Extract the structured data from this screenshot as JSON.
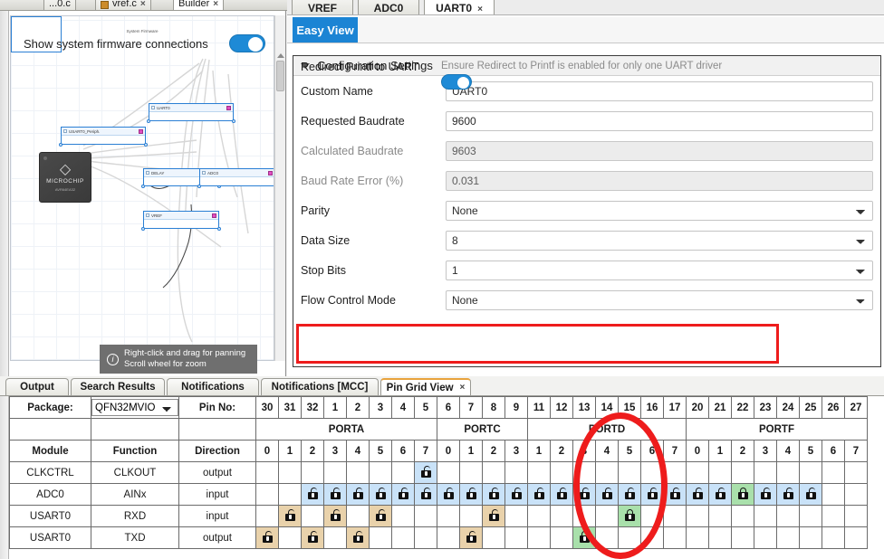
{
  "editor_tabs": [
    {
      "label": "...0.c",
      "closable": false,
      "active": false
    },
    {
      "label": "vref.c",
      "closable": true,
      "active": false
    },
    {
      "label": "Builder",
      "closable": true,
      "active": true
    }
  ],
  "nav_buttons": [
    "◄",
    "►",
    "▾",
    "□"
  ],
  "component_tabs": [
    {
      "label": "VREF",
      "active": false,
      "closable": false
    },
    {
      "label": "ADC0",
      "active": false,
      "closable": false
    },
    {
      "label": "UART0",
      "active": true,
      "closable": true,
      "close_label": "×"
    }
  ],
  "diagram": {
    "show_firmware_label": "Show system firmware connections",
    "show_firmware_on": true,
    "nodes": [
      {
        "name": "System Firmware"
      },
      {
        "name": "UART0"
      },
      {
        "name": "USART0_Periph."
      },
      {
        "name": "DELAY"
      },
      {
        "name": "ADC0"
      },
      {
        "name": "VREF"
      }
    ],
    "chip": {
      "brand": "MICROCHIP",
      "part": "AVR64EA32"
    },
    "hint_line1": "Right-click and drag for panning",
    "hint_line2": "Scroll wheel for zoom",
    "hint_icon": "info-icon"
  },
  "config": {
    "easy_view_label": "Easy View",
    "section_title": "Configuration Settings",
    "fields": [
      {
        "label": "Custom Name",
        "value": "UART0",
        "type": "text",
        "readonly": false
      },
      {
        "label": "Requested Baudrate",
        "value": "9600",
        "type": "text",
        "readonly": false
      },
      {
        "label": "Calculated Baudrate",
        "value": "9603",
        "type": "text",
        "readonly": true
      },
      {
        "label": "Baud Rate Error (%)",
        "value": "0.031",
        "type": "text",
        "readonly": true
      },
      {
        "label": "Parity",
        "value": "None",
        "type": "select",
        "readonly": false
      },
      {
        "label": "Data Size",
        "value": "8",
        "type": "select",
        "readonly": false
      },
      {
        "label": "Stop Bits",
        "value": "1",
        "type": "select",
        "readonly": false
      },
      {
        "label": "Flow Control Mode",
        "value": "None",
        "type": "select",
        "readonly": false
      }
    ],
    "redirect": {
      "label": "Redirect Printf to UART",
      "note": "Ensure Redirect to Printf is enabled for only one UART driver",
      "enabled": true,
      "highlight_color": "#ee1c1c"
    }
  },
  "bottom_tabs": [
    {
      "label": "Output",
      "active": false,
      "closable": false
    },
    {
      "label": "Search Results",
      "active": false,
      "closable": false
    },
    {
      "label": "Notifications",
      "active": false,
      "closable": false
    },
    {
      "label": "Notifications [MCC]",
      "active": false,
      "closable": false
    },
    {
      "label": "Pin Grid View",
      "active": true,
      "closable": true,
      "close_label": "×"
    }
  ],
  "pin_grid": {
    "package_label": "Package:",
    "package_value": "QFN32MVIO",
    "package_options": [
      "QFN32MVIO"
    ],
    "pin_no_label": "Pin No:",
    "col_module": "Module",
    "col_function": "Function",
    "col_direction": "Direction",
    "pin_numbers": [
      "30",
      "31",
      "32",
      "1",
      "2",
      "3",
      "4",
      "5",
      "6",
      "7",
      "8",
      "9",
      "11",
      "12",
      "13",
      "14",
      "15",
      "16",
      "17",
      "20",
      "21",
      "22",
      "23",
      "24",
      "25",
      "26",
      "27"
    ],
    "ports": [
      {
        "name": "PORTA",
        "span": 8
      },
      {
        "name": "PORTC",
        "span": 4
      },
      {
        "name": "",
        "span": 0
      },
      {
        "name": "PORTD",
        "span": 7
      },
      {
        "name": "PORTF",
        "span": 8
      }
    ],
    "port_bits": [
      "0",
      "1",
      "2",
      "3",
      "4",
      "5",
      "6",
      "7",
      "0",
      "1",
      "2",
      "3",
      "1",
      "2",
      "3",
      "4",
      "5",
      "6",
      "7",
      "0",
      "1",
      "2",
      "3",
      "4",
      "5",
      "6",
      "7"
    ],
    "rows": [
      {
        "module": "CLKCTRL",
        "function": "CLKOUT",
        "direction": "output",
        "cells": [
          "",
          "",
          "",
          "",
          "",
          "",
          "",
          "blue",
          "",
          "",
          "",
          "",
          "",
          "",
          "",
          "",
          "",
          "",
          "",
          "",
          "",
          "",
          "",
          "",
          "",
          "",
          ""
        ]
      },
      {
        "module": "ADC0",
        "function": "AINx",
        "direction": "input",
        "cells": [
          "",
          "",
          "blue",
          "blue",
          "blue",
          "blue",
          "blue",
          "blue",
          "blue",
          "blue",
          "blue",
          "blue",
          "blue",
          "blue",
          "blue",
          "blue",
          "blue",
          "blue",
          "blue",
          "blue",
          "blue",
          "green",
          "blue",
          "blue",
          "blue",
          "",
          ""
        ]
      },
      {
        "module": "USART0",
        "function": "RXD",
        "direction": "input",
        "cells": [
          "",
          "tan",
          "",
          "tan",
          "",
          "tan",
          "",
          "",
          "",
          "",
          "tan",
          "",
          "",
          "",
          "",
          "",
          "green",
          "",
          "",
          "",
          "",
          "",
          "",
          "",
          "",
          "",
          ""
        ]
      },
      {
        "module": "USART0",
        "function": "TXD",
        "direction": "output",
        "cells": [
          "tan",
          "",
          "tan",
          "",
          "tan",
          "",
          "",
          "",
          "",
          "tan",
          "",
          "",
          "",
          "",
          "green",
          "",
          "",
          "",
          "",
          "",
          "",
          "",
          "",
          "",
          "",
          "",
          ""
        ]
      }
    ],
    "legend_colors": {
      "available": "#c9e2f8",
      "alternate": "#e9d2ab",
      "locked": "#a9e0ab"
    }
  },
  "annotations": [
    {
      "type": "rect",
      "target": "redirect-printf-row",
      "color": "#ee1c1c"
    },
    {
      "type": "ellipse",
      "target": "portd-columns",
      "color": "#ee1c1c"
    }
  ]
}
